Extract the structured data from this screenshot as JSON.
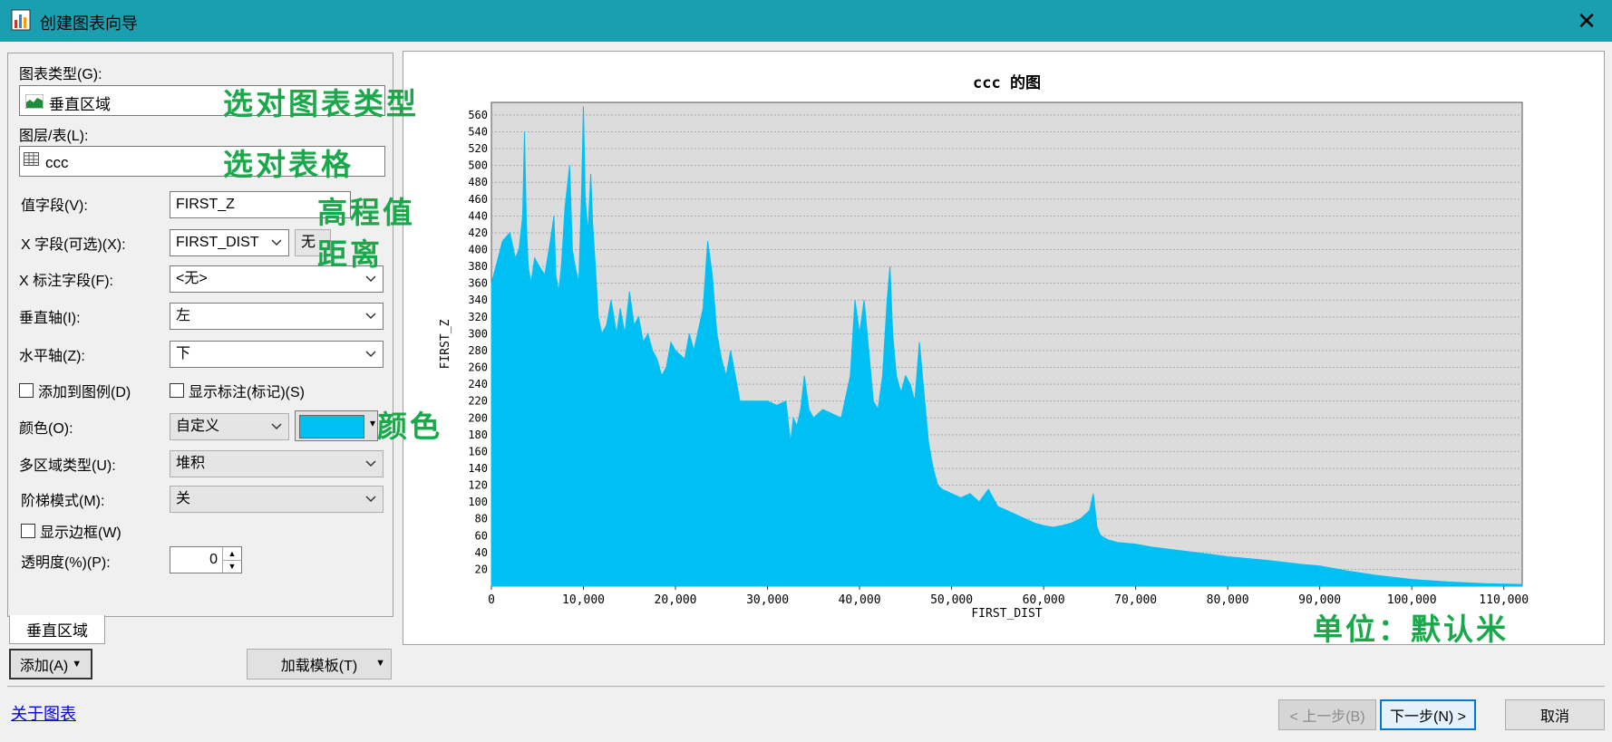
{
  "window": {
    "title": "创建图表向导",
    "close_glyph": "✕"
  },
  "form": {
    "chart_type_label": "图表类型(G):",
    "chart_type_value": "垂直区域",
    "layer_label": "图层/表(L):",
    "layer_value": "ccc",
    "value_field_label": "值字段(V):",
    "value_field_value": "FIRST_Z",
    "x_field_label": "X 字段(可选)(X):",
    "x_field_value": "FIRST_DIST",
    "x_field_extra": "无",
    "x_label_field_label": "X 标注字段(F):",
    "x_label_field_value": "<无>",
    "vertical_axis_label": "垂直轴(I):",
    "vertical_axis_value": "左",
    "horizontal_axis_label": "水平轴(Z):",
    "horizontal_axis_value": "下",
    "add_to_legend_label": "添加到图例(D)",
    "show_labels_label": "显示标注(标记)(S)",
    "color_label": "颜色(O):",
    "color_mode_value": "自定义",
    "color_hex": "#00bff3",
    "multi_area_label": "多区域类型(U):",
    "multi_area_value": "堆积",
    "step_mode_label": "阶梯模式(M):",
    "step_mode_value": "关",
    "show_border_label": "显示边框(W)",
    "transparency_label": "透明度(%)(P):",
    "transparency_value": "0"
  },
  "tab": {
    "label": "垂直区域"
  },
  "buttons": {
    "add": "添加(A)",
    "load_template": "加载模板(T)",
    "back": "< 上一步(B)",
    "next": "下一步(N) >",
    "cancel": "取消"
  },
  "link": {
    "about": "关于图表"
  },
  "annotations": {
    "pick_type": "选对图表类型",
    "pick_table": "选对表格",
    "elevation": "高程值",
    "distance": "距离",
    "color": "颜色",
    "units": "单位：默认米"
  },
  "chart_data": {
    "type": "area",
    "title": "ccc 的图",
    "xlabel": "FIRST_DIST",
    "ylabel": "FIRST_Z",
    "xlim": [
      0,
      112000
    ],
    "ylim": [
      0,
      575
    ],
    "grid": true,
    "color": "#00bff3",
    "x_ticks": [
      "0",
      "10,000",
      "20,000",
      "30,000",
      "40,000",
      "50,000",
      "60,000",
      "70,000",
      "80,000",
      "90,000",
      "100,000",
      "110,000"
    ],
    "y_ticks": [
      "20",
      "40",
      "60",
      "80",
      "100",
      "120",
      "140",
      "160",
      "180",
      "200",
      "220",
      "240",
      "260",
      "280",
      "300",
      "320",
      "340",
      "360",
      "380",
      "400",
      "420",
      "440",
      "460",
      "480",
      "500",
      "520",
      "540",
      "560"
    ],
    "x": [
      0,
      500,
      1200,
      2000,
      2600,
      3000,
      3400,
      3600,
      3800,
      4000,
      4300,
      4700,
      5200,
      5800,
      6400,
      6800,
      7000,
      7300,
      7600,
      8000,
      8500,
      8800,
      9100,
      9300,
      9500,
      9800,
      10000,
      10200,
      10500,
      10800,
      11000,
      11300,
      11600,
      12000,
      12500,
      13000,
      13600,
      14000,
      14500,
      15000,
      15500,
      16000,
      16500,
      17000,
      17500,
      18000,
      18500,
      19000,
      19500,
      20000,
      21000,
      21500,
      22000,
      23000,
      23500,
      24000,
      24500,
      25000,
      25500,
      26000,
      27000,
      28000,
      29000,
      30000,
      31000,
      32000,
      32500,
      32800,
      33200,
      33600,
      34000,
      34500,
      35000,
      36000,
      37000,
      38000,
      39000,
      39500,
      40000,
      40500,
      41000,
      41500,
      42000,
      42500,
      43000,
      43300,
      43600,
      44000,
      44500,
      45000,
      45500,
      46000,
      46500,
      47000,
      47500,
      48000,
      48500,
      49000,
      50000,
      51000,
      52000,
      53000,
      54000,
      55000,
      56000,
      57000,
      58000,
      59000,
      60000,
      61000,
      62000,
      63000,
      64000,
      65000,
      65400,
      65800,
      66200,
      67000,
      68000,
      70000,
      72000,
      75000,
      78000,
      80000,
      84000,
      88000,
      90000,
      93000,
      96000,
      100000,
      104000,
      108000,
      112000
    ],
    "y": [
      360,
      380,
      410,
      420,
      390,
      400,
      440,
      540,
      430,
      380,
      360,
      390,
      380,
      370,
      410,
      440,
      370,
      350,
      380,
      450,
      500,
      400,
      380,
      370,
      360,
      470,
      570,
      460,
      420,
      490,
      430,
      380,
      320,
      300,
      310,
      340,
      300,
      330,
      300,
      350,
      310,
      320,
      290,
      300,
      280,
      270,
      250,
      260,
      290,
      280,
      270,
      300,
      280,
      330,
      410,
      370,
      300,
      270,
      250,
      280,
      220,
      220,
      220,
      220,
      215,
      220,
      170,
      200,
      190,
      210,
      250,
      210,
      200,
      210,
      205,
      200,
      250,
      340,
      300,
      340,
      280,
      220,
      210,
      250,
      340,
      380,
      300,
      250,
      230,
      250,
      240,
      220,
      290,
      230,
      170,
      140,
      120,
      115,
      110,
      105,
      110,
      100,
      115,
      95,
      90,
      85,
      80,
      75,
      72,
      70,
      72,
      75,
      80,
      90,
      110,
      70,
      60,
      55,
      52,
      50,
      46,
      42,
      38,
      35,
      31,
      26,
      24,
      18,
      13,
      8,
      5,
      3,
      2
    ]
  }
}
